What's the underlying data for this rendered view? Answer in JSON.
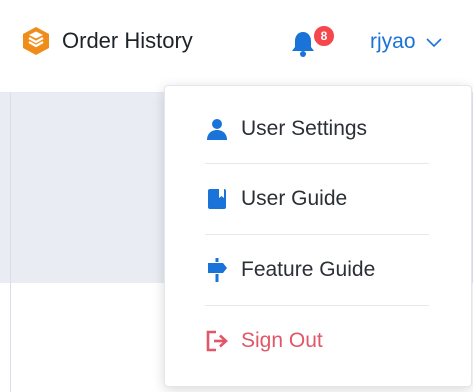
{
  "header": {
    "title": "Order History",
    "notification_count": "8",
    "username": "rjyao",
    "logo_icon": "layers-logo-icon",
    "accent_color": "#1a73d9",
    "brand_color": "#f08c1a"
  },
  "menu": {
    "items": [
      {
        "label": "User Settings",
        "icon": "user-icon"
      },
      {
        "label": "User Guide",
        "icon": "book-icon"
      },
      {
        "label": "Feature Guide",
        "icon": "signpost-icon"
      },
      {
        "label": "Sign Out",
        "icon": "sign-out-icon",
        "color": "#e05767"
      }
    ]
  }
}
